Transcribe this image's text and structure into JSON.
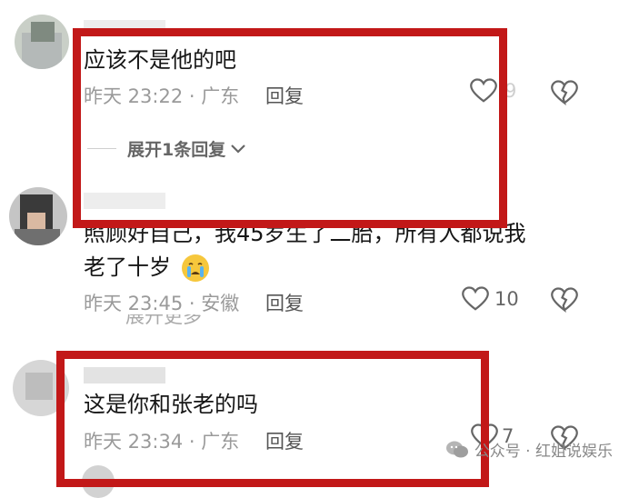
{
  "comments": [
    {
      "text": "应该不是他的吧",
      "meta": "昨天 23:22 · 广东",
      "reply": "回复",
      "likes": "9",
      "expand": "展开1条回复"
    },
    {
      "text_line1": "照顾好自己，我45岁生了二胎，所有人都说我",
      "text_line2": "老了十岁",
      "emoji": "crying-face",
      "meta": "昨天 23:45 · 安徽",
      "reply": "回复",
      "likes": "10",
      "hidden_row": "展开更多"
    },
    {
      "text": "这是你和张老的吗",
      "meta": "昨天 23:34 · 广东",
      "reply": "回复",
      "likes": "7"
    }
  ],
  "watermark": "公众号 · 红姐说娱乐",
  "colors": {
    "highlight": "#c21818",
    "meta": "#9a9a9a",
    "text": "#161616"
  },
  "icons": [
    "heart-icon",
    "broken-heart-icon",
    "chevron-down-icon",
    "wechat-icon"
  ]
}
